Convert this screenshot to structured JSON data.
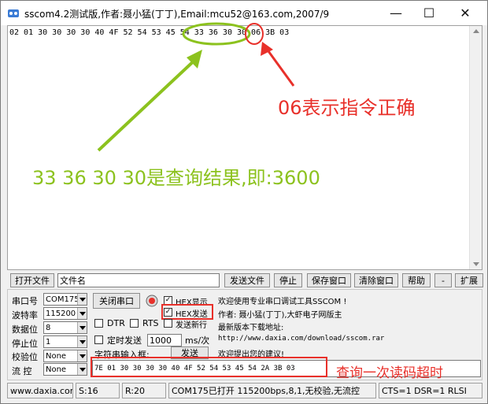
{
  "window": {
    "title": "sscom4.2测试版,作者:聂小猛(丁丁),Email:mcu52@163.com,2007/9",
    "minimize": "—",
    "maximize": "☐",
    "close": "✕"
  },
  "receive": {
    "text": "02 01 30 30 30 30 40 4F 52 54 53 45 54 33 36 30 30 06 3B 03"
  },
  "toolbar": {
    "open_file": "打开文件",
    "filename": "文件名",
    "send_file": "发送文件",
    "stop": "停止",
    "save_window": "保存窗口",
    "clear_window": "清除窗口",
    "help": "帮助",
    "minus": "-",
    "expand": "扩展"
  },
  "settings": {
    "port_label": "串口号",
    "port_value": "COM175",
    "baud_label": "波特率",
    "baud_value": "115200",
    "data_label": "数据位",
    "data_value": "8",
    "stop_label": "停止位",
    "stop_value": "1",
    "parity_label": "校验位",
    "parity_value": "None",
    "flow_label": "流 控",
    "flow_value": "None",
    "close_port": "关闭串口",
    "hex_display": "HEX显示",
    "hex_send": "HEX发送",
    "dtr": "DTR",
    "rts": "RTS",
    "send_newline": "发送新行",
    "timed_send": "定时发送",
    "interval": "1000",
    "interval_unit": "ms/次",
    "char_input": "字符串输入框:",
    "send": "发送"
  },
  "info": {
    "line1": "欢迎使用专业串口调试工具SSCOM !",
    "line2": "作者: 聂小猛(丁丁),大虾电子网版主",
    "line3": "最新版本下载地址:",
    "line4": "http://www.daxia.com/download/sscom.rar",
    "line5": "欢迎提出您的建议!"
  },
  "send_input": {
    "value": "7E 01 30 30 30 30 40 4F 52 54 53 45 54 2A 3B 03"
  },
  "statusbar": {
    "site": "www.daxia.cor",
    "sent": "S:16",
    "received": "R:20",
    "port_status": "COM175已打开  115200bps,8,1,无校验,无流控",
    "signals": "CTS=1 DSR=1 RLSI"
  },
  "annotations": {
    "correct": "06表示指令正确",
    "result": "33 36 30 30是查询结果,即:3600",
    "timeout": "查询一次读码超时",
    "color_red": "#e8302a",
    "color_green": "#8cc21e"
  }
}
